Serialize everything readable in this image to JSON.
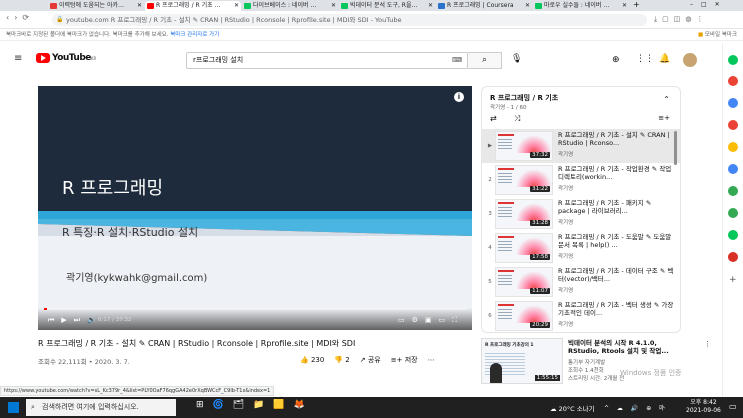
{
  "browser": {
    "tabs": [
      {
        "label": "이력텅에 도움되는 아카…",
        "color": "#e53935"
      },
      {
        "label": "R 프로그래밍 / R 기초 …",
        "color": "#ff0000",
        "active": true
      },
      {
        "label": "다이브베이스 : 네이버 …",
        "color": "#03c75a"
      },
      {
        "label": "빅데이터 분석 도구, R을…",
        "color": "#03c75a"
      },
      {
        "label": "R 프로그래밍 | Coursera",
        "color": "#2a73cc"
      },
      {
        "label": "마로우 실수들 : 네이버 …",
        "color": "#03c75a"
      }
    ],
    "new_tab": "+",
    "url": "youtube.com/watch?v=sL_Kc379r_4&list=PLY0Oa... ",
    "url_display": "youtube.com  R 프로그래밍 / R 기초 - 설치 ✎ CRAN | RStudio | Rconsole | Rprofile.site | MDI와 SDI - YouTube",
    "bookmark_bar_text": "북마크바로 지정된 폴더에 북마크가 없습니다. 북마크를 추가해 보세요.",
    "bookmark_bar_link": "북마크 관리자로 가기",
    "bookmark_other": "모바일 북마크"
  },
  "youtube": {
    "logo_text": "YouTube",
    "logo_sup": "KR",
    "search_value": "r프로그래밍 설치"
  },
  "video": {
    "slide_title": "R 프로그래밍",
    "slide_subtitle": "R 특징·R 설치·RStudio 설치",
    "slide_author": "곽기영(kykwahk@gmail.com)",
    "time": "0:17 / 37:32",
    "progress": 0.008,
    "title": "R 프로그래밍 / R 기초 - 설치 ✎ CRAN | RStudio | Rconsole | Rprofile.site | MDI와 SDI",
    "views": "조회수 22,111회 • 2020. 3. 7.",
    "likes": "230",
    "dislikes": "2",
    "share": "공유",
    "save": "저장"
  },
  "playlist": {
    "title": "R 프로그래밍 / R 기초",
    "meta": "곽기영 - 1 / 60",
    "items": [
      {
        "num": "▶",
        "title": "R 프로그래밍 / R 기초 - 설치 ✎ CRAN | RStudio | Rconso...",
        "channel": "곽기영",
        "duration": "37:32"
      },
      {
        "num": "2",
        "title": "R 프로그래밍 / R 기초 - 작업환경 ✎ 작업 디렉토리(workin...",
        "channel": "곽기영",
        "duration": "31:22"
      },
      {
        "num": "3",
        "title": "R 프로그래밍 / R 기초 - 패키지 ✎ package | 라이브러리...",
        "channel": "곽기영",
        "duration": "31:28"
      },
      {
        "num": "4",
        "title": "R 프로그래밍 / R 기초 - 도움말 ✎ 도움말 문서 목록 | help() ...",
        "channel": "곽기영",
        "duration": "17:58"
      },
      {
        "num": "5",
        "title": "R 프로그래밍 / R 기초 - 데이터 구조 ✎ 벡터(vector)/백터...",
        "channel": "곽기영",
        "duration": "11:07"
      },
      {
        "num": "6",
        "title": "R 프로그래밍 / R 기초 - 벡터 생성 ✎ 가장 기초적인 데이...",
        "channel": "곽기영",
        "duration": "20:29"
      }
    ]
  },
  "recommended": {
    "title": "빅데이터 분석의 시작 R 4.1.0, RStudio, Rtools 설치 및 작업...",
    "channel": "통기부 자기계발",
    "views": "조회수 1.4천회",
    "meta": "스트리밍 시간: 2개월 전",
    "duration": "1:55:15",
    "thumb_text": "R 프로그래밍 기초강의 1"
  },
  "status_url": "https://www.youtube.com/watch?v=sL_Kc379r_4&list=PLY0OaF76qgGA42e0rXqBWCcF_C9lb-T1x&index=1",
  "windows_watermark": "Windows 정품 인증",
  "taskbar": {
    "search_placeholder": "검색하려면 여기에 입력하십시오.",
    "weather": "20°C 소나기",
    "time": "오후 8:42",
    "date": "2021-09-06"
  },
  "colors": {
    "accent_red": "#ff0000",
    "video_bg": "#1d2a3a",
    "taskbar": "#202020"
  }
}
